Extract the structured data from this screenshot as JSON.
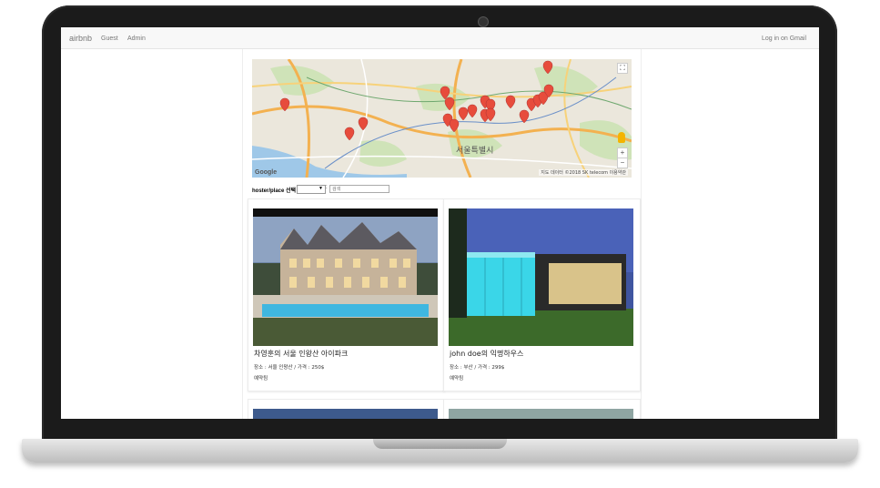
{
  "navbar": {
    "brand": "airbnb",
    "links": [
      "Guest",
      "Admin"
    ],
    "login": "Log in on Gmail"
  },
  "map": {
    "city_label": "서울특별시",
    "logo": "Google",
    "attribution": "지도 데이터 ©2018 SK telecom 이용약관",
    "zoom_in": "+",
    "zoom_out": "−",
    "fullscreen": "⛶",
    "marker_color": "#e74c3c"
  },
  "filter": {
    "label": "hoster/place 선택",
    "select_value": "",
    "select_arrow": "▼",
    "separator": ":",
    "search_placeholder": "검색"
  },
  "listings": [
    {
      "title": "차영훈의 서울 인왕산 아이파크",
      "info": "장소 : 서울 인왕산 / 가격 : 250$",
      "status": "예약됨"
    },
    {
      "title": "john doe의 익명하우스",
      "info": "장소 : 부산 / 가격 : 299$",
      "status": "예약됨"
    }
  ],
  "colors": {
    "navbar_bg": "#f8f8f8",
    "laptop_frame": "#1b1b1b"
  }
}
